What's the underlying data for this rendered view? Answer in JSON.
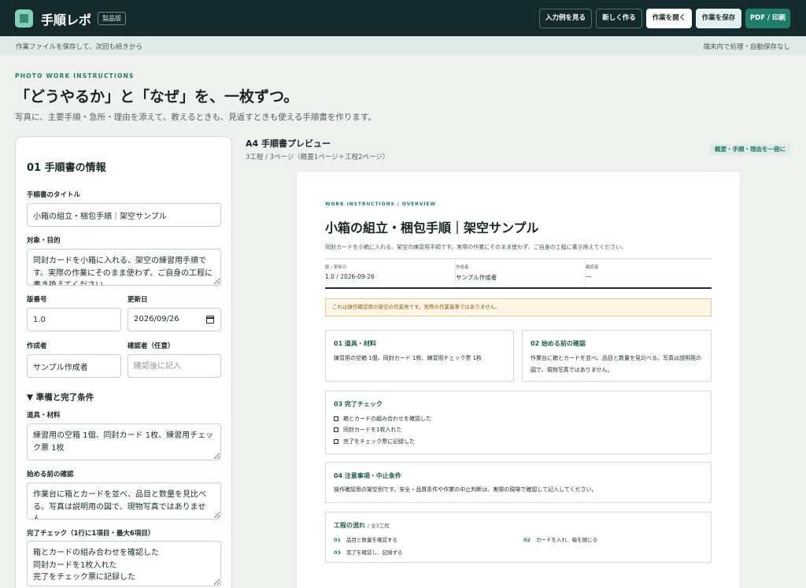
{
  "header": {
    "app_title": "手順レポ",
    "edition_badge": "製品版",
    "buttons": {
      "example": "入力例を見る",
      "new": "新しく作る",
      "open": "作業を開く",
      "save": "作業を保存",
      "pdf": "PDF / 印刷"
    }
  },
  "subbar": {
    "left": "作業ファイルを保存して、次回も続きから",
    "right": "端末内で処理・自動保存なし"
  },
  "hero": {
    "kicker": "PHOTO WORK INSTRUCTIONS",
    "headline": "「どうやるか」と「なぜ」を、一枚ずつ。",
    "lead": "写真に、主要手順・急所・理由を添えて。教えるときも、見返すときも使える手順書を作ります。"
  },
  "form": {
    "section_title": "01 手順書の情報",
    "title_label": "手順書のタイトル",
    "title_value": "小箱の組立・梱包手順｜架空サンプル",
    "purpose_label": "対象・目的",
    "purpose_value": "同封カードを小箱に入れる、架空の練習用手順です。実際の作業にそのまま使わず、ご自身の工程に書き換えてください。",
    "version_label": "版番号",
    "version_value": "1.0",
    "date_label": "更新日",
    "date_value": "2026/09/26",
    "author_label": "作成者",
    "author_value": "サンプル作成者",
    "reviewer_label": "確認者（任意）",
    "reviewer_placeholder": "確認後に記入",
    "prep_toggle": "▼ 準備と完了条件",
    "tools_label": "道具・材料",
    "tools_value": "練習用の空箱 1個、同封カード 1枚、練習用チェック票 1枚",
    "before_label": "始める前の確認",
    "before_value": "作業台に箱とカードを並べ、品目と数量を見比べる。写真は説明用の図で、現物写真ではありません。",
    "check_label": "完了チェック（1行に1項目・最大6項目）",
    "check_value": "箱とカードの組み合わせを確認した\n同封カードを1枚入れた\n完了をチェック票に記録した"
  },
  "preview": {
    "title": "A4 手順書プレビュー",
    "meta": "3工程 / 3ページ（概要1ページ＋工程2ページ）",
    "tag": "概要・手順・理由を一冊に",
    "page": {
      "kicker": "WORK INSTRUCTIONS / OVERVIEW",
      "title": "小箱の組立・梱包手順｜架空サンプル",
      "description": "同封カードを小箱に入れる、架空の練習用手順です。実際の作業にそのまま使わず、ご自身の工程に書き換えてください。",
      "info": {
        "version_label": "版 / 更新日",
        "version_value": "1.0 / 2026-09-26",
        "author_label": "作成者",
        "author_value": "サンプル作成者",
        "reviewer_label": "確認者",
        "reviewer_value": "—"
      },
      "notice": "これは操作確認用の架空の作業例です。実際の作業基準ではありません。",
      "tools": {
        "title": "01 道具・材料",
        "body": "練習用の空箱 1個、同封カード 1枚、練習用チェック票 1枚"
      },
      "before": {
        "title": "02 始める前の確認",
        "body": "作業台に箱とカードを並べ、品目と数量を見比べる。写真は説明用の図で、現物写真ではありません。"
      },
      "checks": {
        "title": "03 完了チェック",
        "items": [
          "箱とカードの組み合わせを確認した",
          "同封カードを1枚入れた",
          "完了をチェック票に記録した"
        ]
      },
      "cautions": {
        "title": "04 注意事項・中止条件",
        "body": "操作確認用の架空例です。安全・品質条件や作業の中止判断は、実際の現場で確認して記入してください。"
      },
      "flow": {
        "title": "工程の流れ",
        "count": "/ 全3工程",
        "steps": [
          {
            "num": "01",
            "text": "品目と数量を確認する"
          },
          {
            "num": "02",
            "text": "カードを入れ、箱を閉じる"
          },
          {
            "num": "03",
            "text": "完了を確認し、記録する"
          }
        ]
      }
    }
  }
}
